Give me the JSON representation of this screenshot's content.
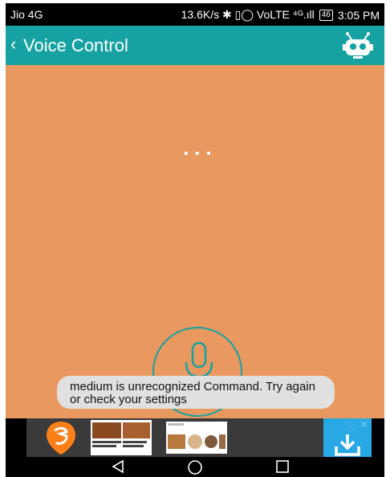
{
  "status_bar": {
    "carrier": "Jio 4G",
    "right_text": "13.6K/s ✱ ▯◯ VoLTE ⁴ᴳ.ıll",
    "battery": "46",
    "time": "3:05 PM"
  },
  "app_bar": {
    "title": "Voice Control",
    "colors": {
      "primary": "#16a2a2"
    }
  },
  "content": {
    "status_text": "• • •",
    "toast": "medium is unrecognized Command. Try again or check your settings",
    "background_color": "#e99860"
  },
  "ad": {
    "info_icon": "info-icon",
    "close_icon": "close-icon"
  },
  "nav_bar": {
    "buttons": [
      "back",
      "home",
      "recents"
    ]
  }
}
